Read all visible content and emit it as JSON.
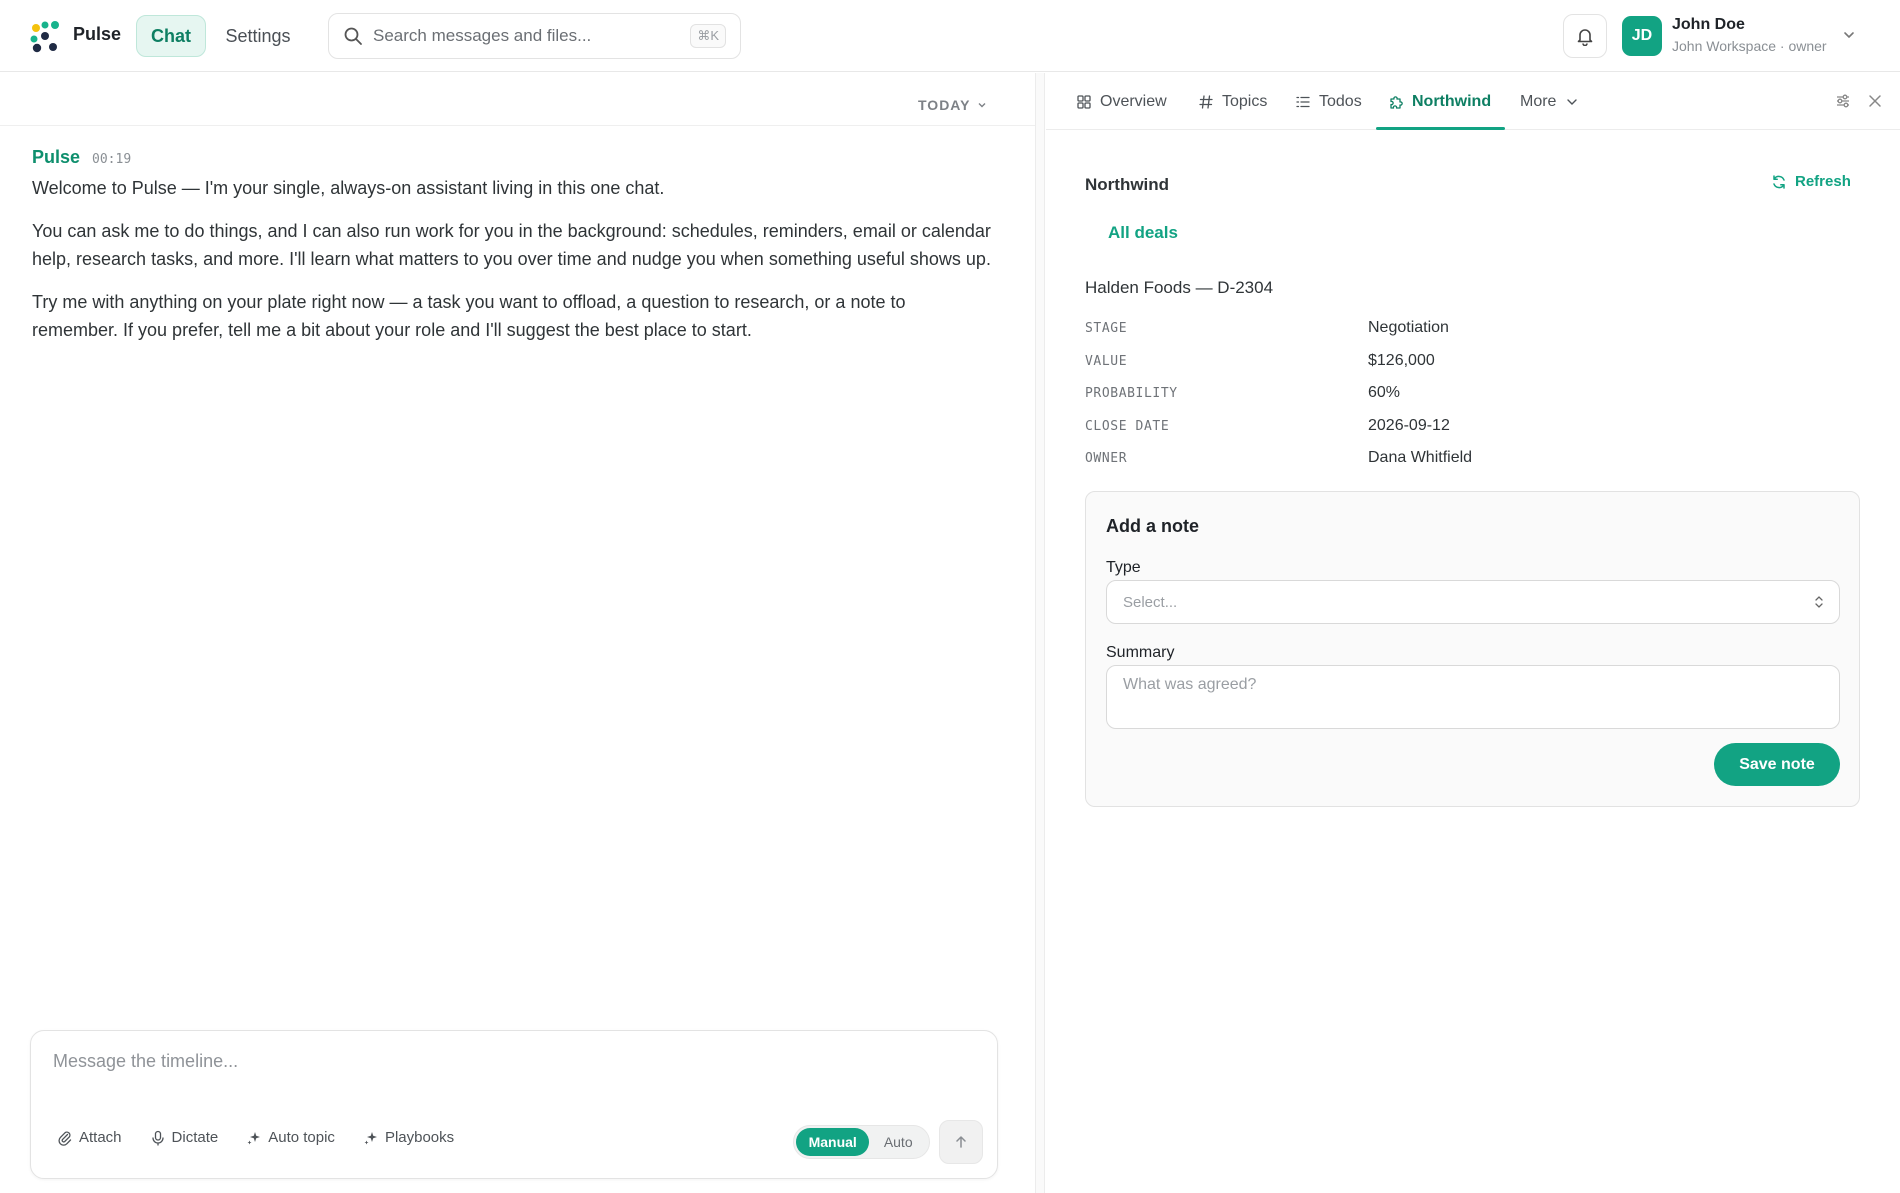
{
  "app": {
    "brand": "Pulse"
  },
  "nav": {
    "chat": "Chat",
    "settings": "Settings"
  },
  "search": {
    "placeholder": "Search messages and files...",
    "shortcut": "⌘K"
  },
  "user": {
    "initials": "JD",
    "name": "John Doe",
    "workspace": "John Workspace · owner"
  },
  "timeline": {
    "date_filter": "TODAY",
    "message": {
      "author": "Pulse",
      "time": "00:19",
      "paragraphs": [
        "Welcome to Pulse — I'm your single, always-on assistant living in this one chat.",
        "You can ask me to do things, and I can also run work for you in the background: schedules, reminders, email or calendar help, research tasks, and more. I'll learn what matters to you over time and nudge you when something useful shows up.",
        "Try me with anything on your plate right now — a task you want to offload, a question to research, or a note to remember. If you prefer, tell me a bit about your role and I'll suggest the best place to start."
      ]
    }
  },
  "composer": {
    "placeholder": "Message the timeline...",
    "tools": [
      "Attach",
      "Dictate",
      "Auto topic",
      "Playbooks"
    ],
    "mode_manual": "Manual",
    "mode_auto": "Auto",
    "mode_selected": "Manual"
  },
  "panel": {
    "tabs": [
      {
        "label": "Overview",
        "icon": "grid-icon"
      },
      {
        "label": "Topics",
        "icon": "hash-icon"
      },
      {
        "label": "Todos",
        "icon": "list-icon"
      },
      {
        "label": "Northwind",
        "icon": "puzzle-icon",
        "active": true
      },
      {
        "label": "More",
        "icon": "chevron-down-icon"
      }
    ],
    "title": "Northwind",
    "refresh": "Refresh",
    "all_deals": "All deals",
    "deal_name": "Halden Foods — D-2304",
    "fields": [
      {
        "label": "STAGE",
        "value": "Negotiation"
      },
      {
        "label": "VALUE",
        "value": "$126,000"
      },
      {
        "label": "PROBABILITY",
        "value": "60%"
      },
      {
        "label": "CLOSE DATE",
        "value": "2026-09-12"
      },
      {
        "label": "OWNER",
        "value": "Dana Whitfield"
      }
    ],
    "note": {
      "title": "Add a note",
      "type_label": "Type",
      "type_placeholder": "Select...",
      "summary_label": "Summary",
      "summary_placeholder": "What was agreed?",
      "save": "Save note"
    }
  },
  "colors": {
    "accent": "#12a383",
    "accent_dark": "#0e7f63",
    "logo_yellow": "#f4c20d",
    "logo_teal": "#17b38c",
    "logo_navy": "#1f2a44"
  }
}
